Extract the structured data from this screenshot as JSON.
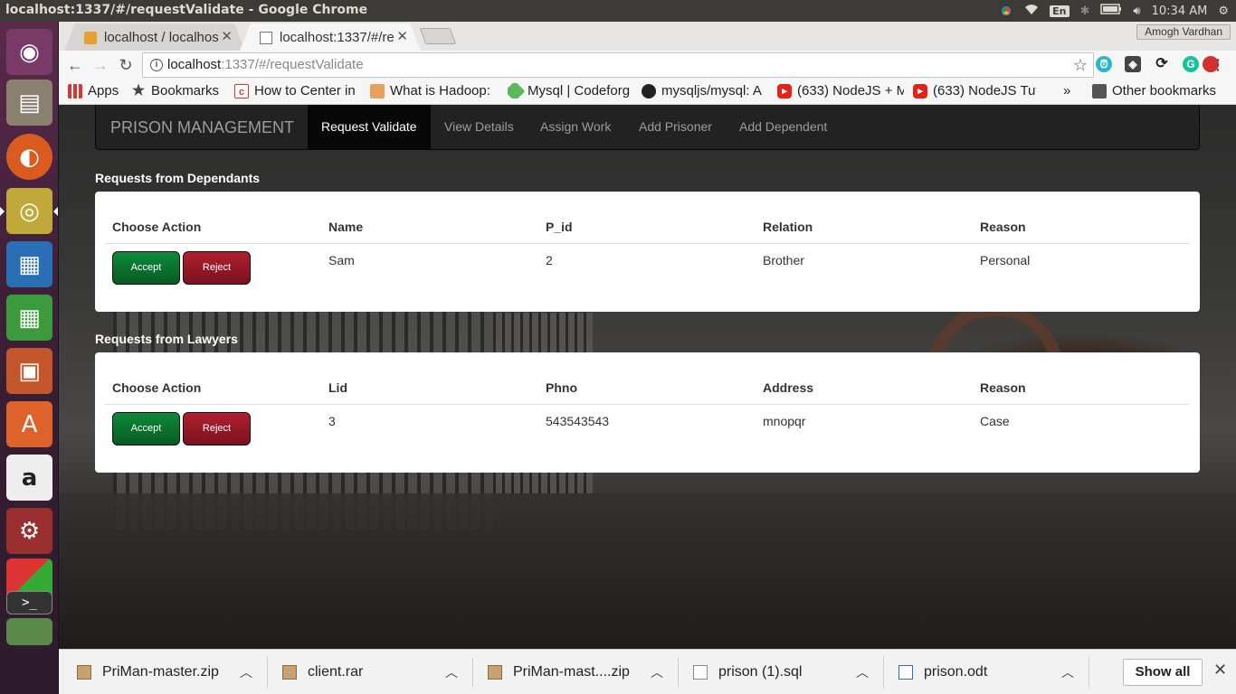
{
  "os": {
    "window_title": "localhost:1337/#/requestValidate - Google Chrome",
    "keyboard_layout": "En",
    "clock": "10:34 AM"
  },
  "chrome": {
    "user": "Amogh Vardhan",
    "tabs": [
      {
        "label": "localhost / localhos",
        "close": "✕"
      },
      {
        "label": "localhost:1337/#/re",
        "close": "✕"
      }
    ],
    "omnibox": {
      "host": "localhost",
      "path": ":1337/#/requestValidate"
    },
    "bookmarks": [
      {
        "label": "Apps",
        "icon": "apps-grid-icon"
      },
      {
        "label": "Bookmarks",
        "icon": "star-icon"
      },
      {
        "label": "How to Center in",
        "icon": "codepen-icon"
      },
      {
        "label": "What is Hadoop:",
        "icon": "hadoop-icon"
      },
      {
        "label": "Mysql | Codeforg",
        "icon": "codeforgeek-icon"
      },
      {
        "label": "mysqljs/mysql: A",
        "icon": "github-icon"
      },
      {
        "label": "(633) NodeJS + M",
        "icon": "youtube-icon"
      },
      {
        "label": "(633) NodeJS Tut",
        "icon": "youtube-icon"
      }
    ],
    "bookmarks_overflow": "»",
    "other_bookmarks": "Other bookmarks"
  },
  "app": {
    "brand": "PRISON MANAGEMENT",
    "nav": [
      "Request Validate",
      "View Details",
      "Assign Work",
      "Add Prisoner",
      "Add Dependent"
    ],
    "active_nav": "Request Validate",
    "dependants": {
      "title": "Requests from Dependants",
      "headers": [
        "Choose Action",
        "Name",
        "P_id",
        "Relation",
        "Reason"
      ],
      "rows": [
        {
          "accept": "Accept",
          "reject": "Reject",
          "cells": [
            "Sam",
            "2",
            "Brother",
            "Personal"
          ]
        }
      ]
    },
    "lawyers": {
      "title": "Requests from Lawyers",
      "headers": [
        "Choose Action",
        "Lid",
        "Phno",
        "Address",
        "Reason"
      ],
      "rows": [
        {
          "accept": "Accept",
          "reject": "Reject",
          "cells": [
            "3",
            "543543543",
            "mnopqr",
            "Case"
          ]
        }
      ]
    }
  },
  "downloads": {
    "items": [
      "PriMan-master.zip",
      "client.rar",
      "PriMan-mast....zip",
      "prison (1).sql",
      "prison.odt"
    ],
    "show_all": "Show all",
    "close": "✕"
  },
  "colors": {
    "accept": "#0e8a3a",
    "reject": "#b0202e",
    "navbar": "#222222"
  }
}
